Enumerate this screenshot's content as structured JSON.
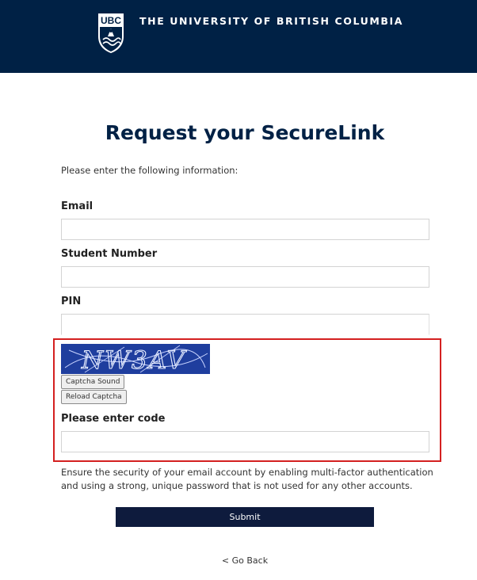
{
  "header": {
    "logo_text": "UBC",
    "university_name": "THE UNIVERSITY OF BRITISH COLUMBIA",
    "background_color": "#002145"
  },
  "page": {
    "title": "Request your SecureLink",
    "intro": "Please enter the following information:"
  },
  "form": {
    "email": {
      "label": "Email",
      "value": ""
    },
    "student_number": {
      "label": "Student Number",
      "value": ""
    },
    "pin": {
      "label": "PIN",
      "value": ""
    },
    "captcha": {
      "image_text": "NW3AV",
      "sound_button": "Captcha Sound",
      "reload_button": "Reload Captcha",
      "code_label": "Please enter code",
      "code_value": "",
      "highlight_color": "#d42020"
    },
    "notice": "Ensure the security of your email account by enabling multi-factor authentication and using a strong, unique password that is not used for any other accounts.",
    "submit_label": "Submit",
    "submit_color": "#0e1b3d"
  },
  "footer": {
    "back_link": "< Go Back"
  }
}
